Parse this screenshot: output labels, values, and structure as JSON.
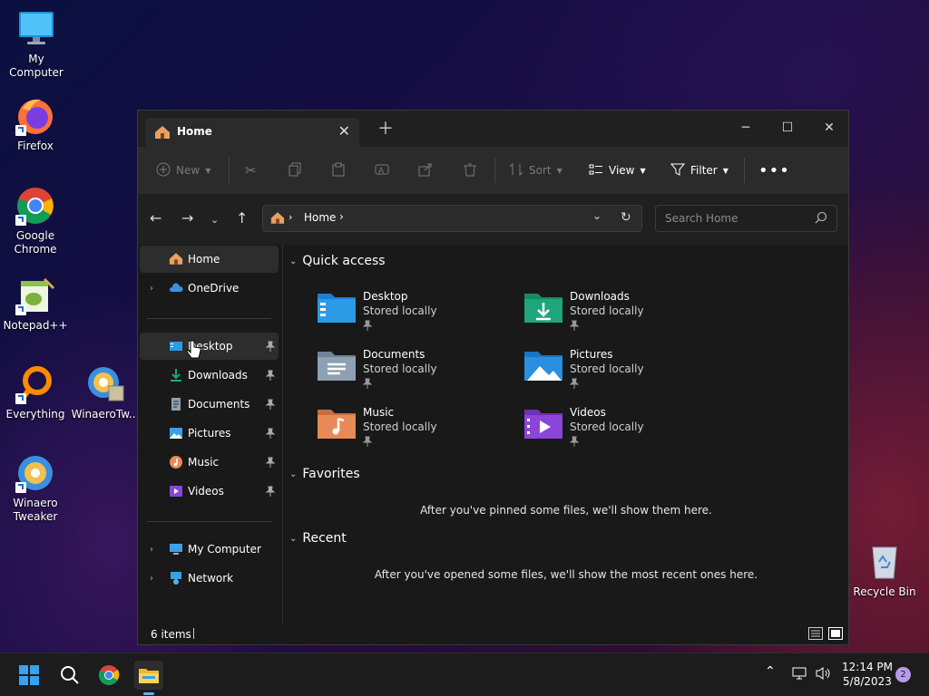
{
  "desktop": {
    "icons": [
      {
        "label": "My Computer"
      },
      {
        "label": "Firefox"
      },
      {
        "label": "Google Chrome"
      },
      {
        "label": "Notepad++"
      },
      {
        "label": "Everything"
      },
      {
        "label": "WinaeroTw..."
      },
      {
        "label": "Winaero Tweaker"
      },
      {
        "label": "Recycle Bin"
      }
    ]
  },
  "window": {
    "tab_title": "Home",
    "toolbar": {
      "new": "New",
      "sort": "Sort",
      "view": "View",
      "filter": "Filter"
    },
    "address": {
      "crumb": "Home"
    },
    "search": {
      "placeholder": "Search Home"
    },
    "sidebar": {
      "top": [
        {
          "label": "Home"
        },
        {
          "label": "OneDrive"
        }
      ],
      "pinned": [
        {
          "label": "Desktop"
        },
        {
          "label": "Downloads"
        },
        {
          "label": "Documents"
        },
        {
          "label": "Pictures"
        },
        {
          "label": "Music"
        },
        {
          "label": "Videos"
        }
      ],
      "bottom": [
        {
          "label": "My Computer"
        },
        {
          "label": "Network"
        }
      ]
    },
    "sections": {
      "quick_access": "Quick access",
      "favorites": "Favorites",
      "recent": "Recent",
      "favorites_empty": "After you've pinned some files, we'll show them here.",
      "recent_empty": "After you've opened some files, we'll show the most recent ones here."
    },
    "quick_access": [
      {
        "name": "Desktop",
        "status": "Stored locally"
      },
      {
        "name": "Downloads",
        "status": "Stored locally"
      },
      {
        "name": "Documents",
        "status": "Stored locally"
      },
      {
        "name": "Pictures",
        "status": "Stored locally"
      },
      {
        "name": "Music",
        "status": "Stored locally"
      },
      {
        "name": "Videos",
        "status": "Stored locally"
      }
    ],
    "status_bar": {
      "items": "6 items"
    }
  },
  "taskbar": {
    "time": "12:14 PM",
    "date": "5/8/2023",
    "notification_count": "2"
  },
  "colors": {
    "accent": "#0078d4",
    "folder_blue": "#2b9be8",
    "folder_green": "#1fa57a",
    "folder_gray": "#8ea0b4",
    "folder_orange": "#e88a58",
    "folder_purple": "#8b45d8"
  }
}
